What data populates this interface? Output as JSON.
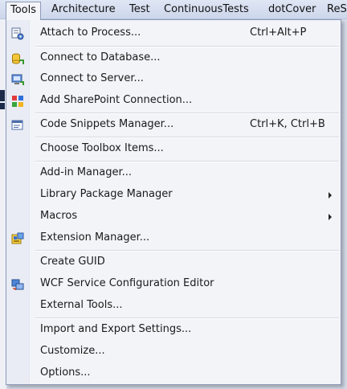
{
  "menubar": {
    "items": [
      {
        "label": "Tools"
      },
      {
        "label": "Architecture"
      },
      {
        "label": "Test"
      },
      {
        "label": "ContinuousTests"
      },
      {
        "label": "dotCover"
      },
      {
        "label": "ReS"
      }
    ]
  },
  "menu": {
    "attach": {
      "label": "Attach to Process...",
      "shortcut": "Ctrl+Alt+P",
      "icon": "attach-process-icon"
    },
    "connect_db": {
      "label": "Connect to Database...",
      "icon": "database-connect-icon"
    },
    "connect_server": {
      "label": "Connect to Server...",
      "icon": "server-connect-icon"
    },
    "sharepoint": {
      "label": "Add SharePoint Connection...",
      "icon": "sharepoint-icon"
    },
    "snippets": {
      "label": "Code Snippets Manager...",
      "shortcut": "Ctrl+K, Ctrl+B",
      "icon": "code-snippets-icon"
    },
    "toolbox": {
      "label": "Choose Toolbox Items..."
    },
    "addin": {
      "label": "Add-in Manager..."
    },
    "library": {
      "label": "Library Package Manager",
      "submenu": true
    },
    "macros": {
      "label": "Macros",
      "submenu": true
    },
    "extension": {
      "label": "Extension Manager...",
      "icon": "extension-manager-icon"
    },
    "guid": {
      "label": "Create GUID"
    },
    "wcf": {
      "label": "WCF Service Configuration Editor",
      "icon": "wcf-editor-icon"
    },
    "external": {
      "label": "External Tools..."
    },
    "import_export": {
      "label": "Import and Export Settings..."
    },
    "customize": {
      "label": "Customize..."
    },
    "options": {
      "label": "Options..."
    }
  },
  "colors": {
    "menu_background": "#f3f4f8",
    "gutter": "#e9ecf4",
    "border": "#8e9bb8",
    "menubar": "#d5ddef"
  }
}
